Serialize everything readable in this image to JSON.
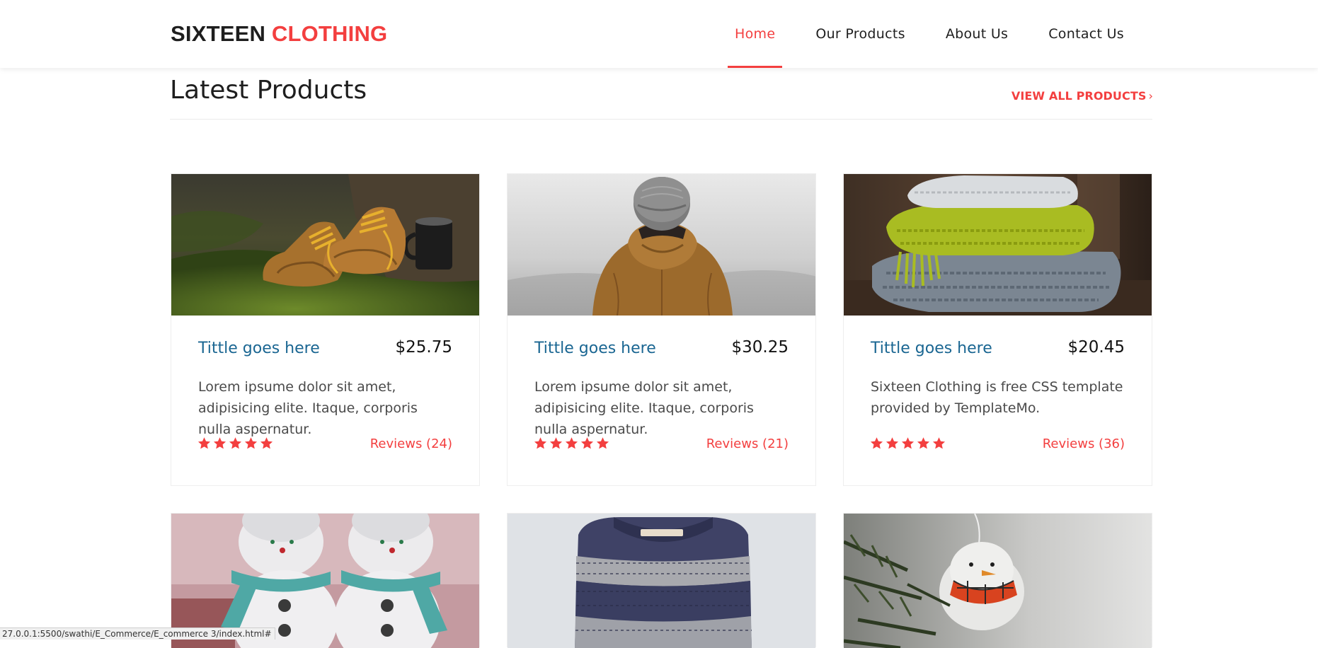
{
  "brand": {
    "name_part1": "SIXTEEN",
    "name_part2": "CLOTHING",
    "accent_color": "#f33f3f"
  },
  "nav": {
    "items": [
      {
        "label": "Home",
        "active": true
      },
      {
        "label": "Our Products",
        "active": false
      },
      {
        "label": "About Us",
        "active": false
      },
      {
        "label": "Contact Us",
        "active": false
      }
    ]
  },
  "section": {
    "title": "Latest Products",
    "view_all_label": "VIEW ALL PRODUCTS",
    "view_all_icon": "chevron-right-icon"
  },
  "products": [
    {
      "title": "Tittle goes here",
      "price": "$25.75",
      "description": "Lorem ipsume dolor sit amet, adipisicing elite. Itaque, corporis nulla aspernatur.",
      "rating": 5,
      "reviews": "Reviews (24)",
      "image": "boots-on-moss"
    },
    {
      "title": "Tittle goes here",
      "price": "$30.25",
      "description": "Lorem ipsume dolor sit amet, adipisicing elite. Itaque, corporis nulla aspernatur.",
      "rating": 5,
      "reviews": "Reviews (21)",
      "image": "person-in-hooded-jacket"
    },
    {
      "title": "Tittle goes here",
      "price": "$20.45",
      "description": "Sixteen Clothing is free CSS template provided by TemplateMo.",
      "rating": 5,
      "reviews": "Reviews (36)",
      "image": "folded-knit-scarves"
    },
    {
      "image": "knitted-snowmen"
    },
    {
      "image": "striped-sweater"
    },
    {
      "image": "snowman-ornament"
    }
  ],
  "status_bar": {
    "url": "27.0.0.1:5500/swathi/E_Commerce/E_commerce 3/index.html#"
  }
}
